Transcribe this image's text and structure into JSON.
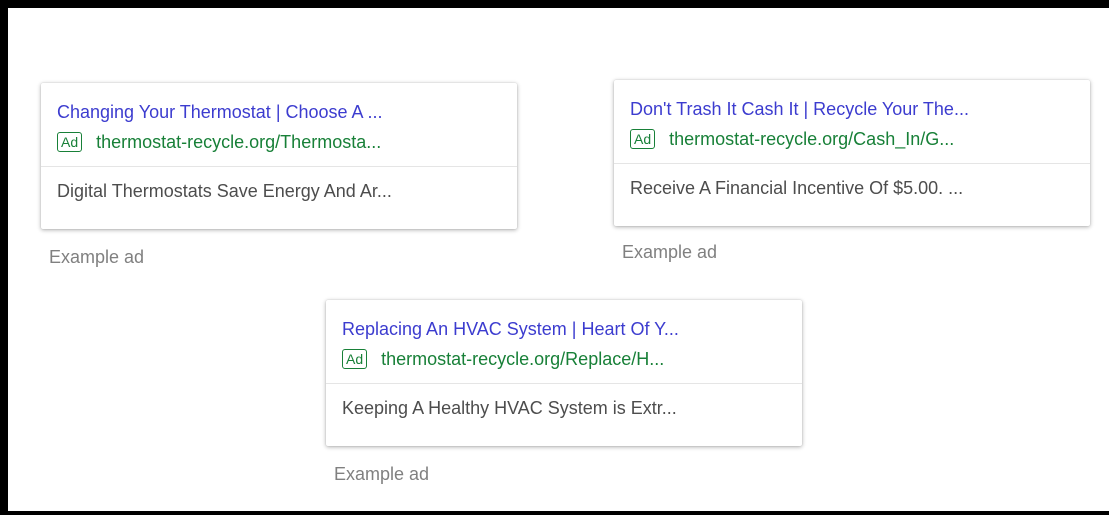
{
  "ads": [
    {
      "title": "Changing Your Thermostat | Choose A ...",
      "badge": "Ad",
      "display_url": "thermostat-recycle.org/Thermosta...",
      "description": "Digital Thermostats Save Energy And Ar...",
      "example_label": "Example ad"
    },
    {
      "title": "Don't Trash It Cash It | Recycle Your The...",
      "badge": "Ad",
      "display_url": "thermostat-recycle.org/Cash_In/G...",
      "description": "Receive A Financial Incentive Of $5.00. ...",
      "example_label": "Example ad"
    },
    {
      "title": "Replacing An HVAC System | Heart Of Y...",
      "badge": "Ad",
      "display_url": "thermostat-recycle.org/Replace/H...",
      "description": "Keeping A Healthy HVAC System is Extr...",
      "example_label": "Example ad"
    }
  ],
  "colors": {
    "title_link": "#3c3ccf",
    "url_green": "#188038",
    "description": "#4d4d4d",
    "label_gray": "#808080",
    "frame_border": "#000000"
  }
}
